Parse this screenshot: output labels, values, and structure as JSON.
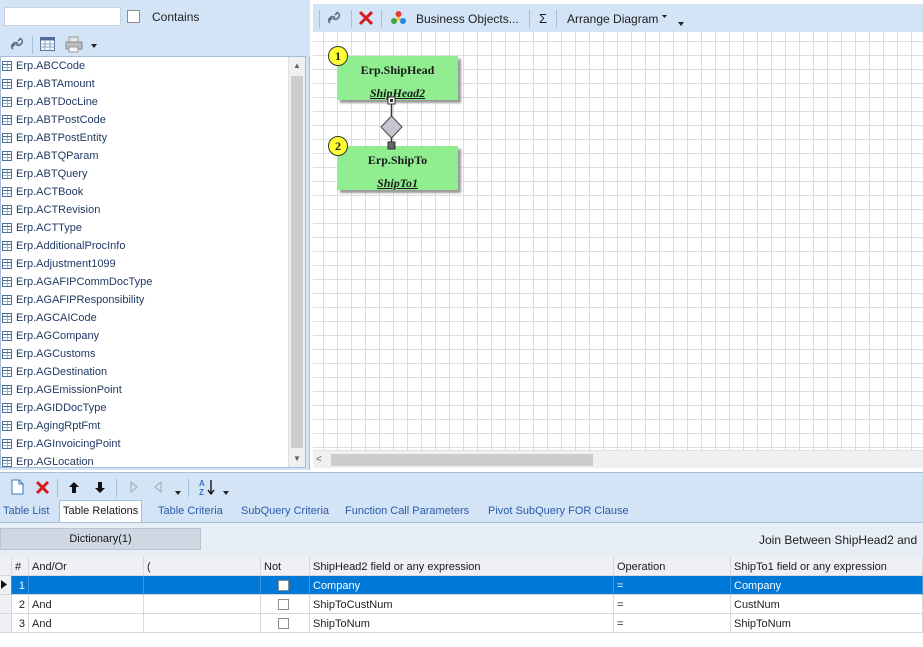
{
  "left_pane": {
    "search": {
      "value": "",
      "placeholder": ""
    },
    "contains_label": "Contains",
    "contains_checked": false,
    "toolbar_icons": [
      "link-icon",
      "grid-icon",
      "print-icon",
      "dropdown-arrow-icon"
    ],
    "tables": [
      "Erp.ABCCode",
      "Erp.ABTAmount",
      "Erp.ABTDocLine",
      "Erp.ABTPostCode",
      "Erp.ABTPostEntity",
      "Erp.ABTQParam",
      "Erp.ABTQuery",
      "Erp.ACTBook",
      "Erp.ACTRevision",
      "Erp.ACTType",
      "Erp.AdditionalProcInfo",
      "Erp.Adjustment1099",
      "Erp.AGAFIPCommDocType",
      "Erp.AGAFIPResponsibility",
      "Erp.AGCAICode",
      "Erp.AGCompany",
      "Erp.AGCustoms",
      "Erp.AGDestination",
      "Erp.AGEmissionPoint",
      "Erp.AGIDDocType",
      "Erp.AgingRptFmt",
      "Erp.AGInvoicingPoint",
      "Erp.AGLocation"
    ]
  },
  "diagram_toolbar": {
    "business_objects_label": "Business Objects...",
    "sum_label": "Σ",
    "arrange_label": "Arrange Diagram"
  },
  "diagram": {
    "entities": [
      {
        "number": "1",
        "name": "Erp.ShipHead",
        "alias": "ShipHead2"
      },
      {
        "number": "2",
        "name": "Erp.ShipTo",
        "alias": "ShipTo1"
      }
    ]
  },
  "tabs": [
    {
      "label": "Table List",
      "active": false
    },
    {
      "label": "Table Relations",
      "active": true
    },
    {
      "label": "Table Criteria",
      "active": false
    },
    {
      "label": "SubQuery Criteria",
      "active": false
    },
    {
      "label": "Function Call Parameters",
      "active": false
    },
    {
      "label": "Pivot SubQuery FOR Clause",
      "active": false
    }
  ],
  "relations": {
    "dictionary_button": "Dictionary(1)",
    "join_label": "Join Between ShipHead2 and",
    "columns": [
      "#",
      "And/Or",
      "(",
      "Not",
      "ShipHead2 field or any expression",
      "Operation",
      "ShipTo1 field or any expression"
    ],
    "rows": [
      {
        "num": "1",
        "andor": "",
        "paren": "",
        "not": false,
        "left": "Company",
        "op": "=",
        "right": "Company",
        "selected": true
      },
      {
        "num": "2",
        "andor": "And",
        "paren": "",
        "not": false,
        "left": "ShipToCustNum",
        "op": "=",
        "right": "CustNum",
        "selected": false
      },
      {
        "num": "3",
        "andor": "And",
        "paren": "",
        "not": false,
        "left": "ShipToNum",
        "op": "=",
        "right": "ShipToNum",
        "selected": false
      }
    ]
  },
  "colors": {
    "panel_bg": "#d4e4f7",
    "entity_fill": "#90ee90",
    "badge_fill": "#ffff33",
    "selection": "#0078d7",
    "delete_red": "#d9191c"
  }
}
